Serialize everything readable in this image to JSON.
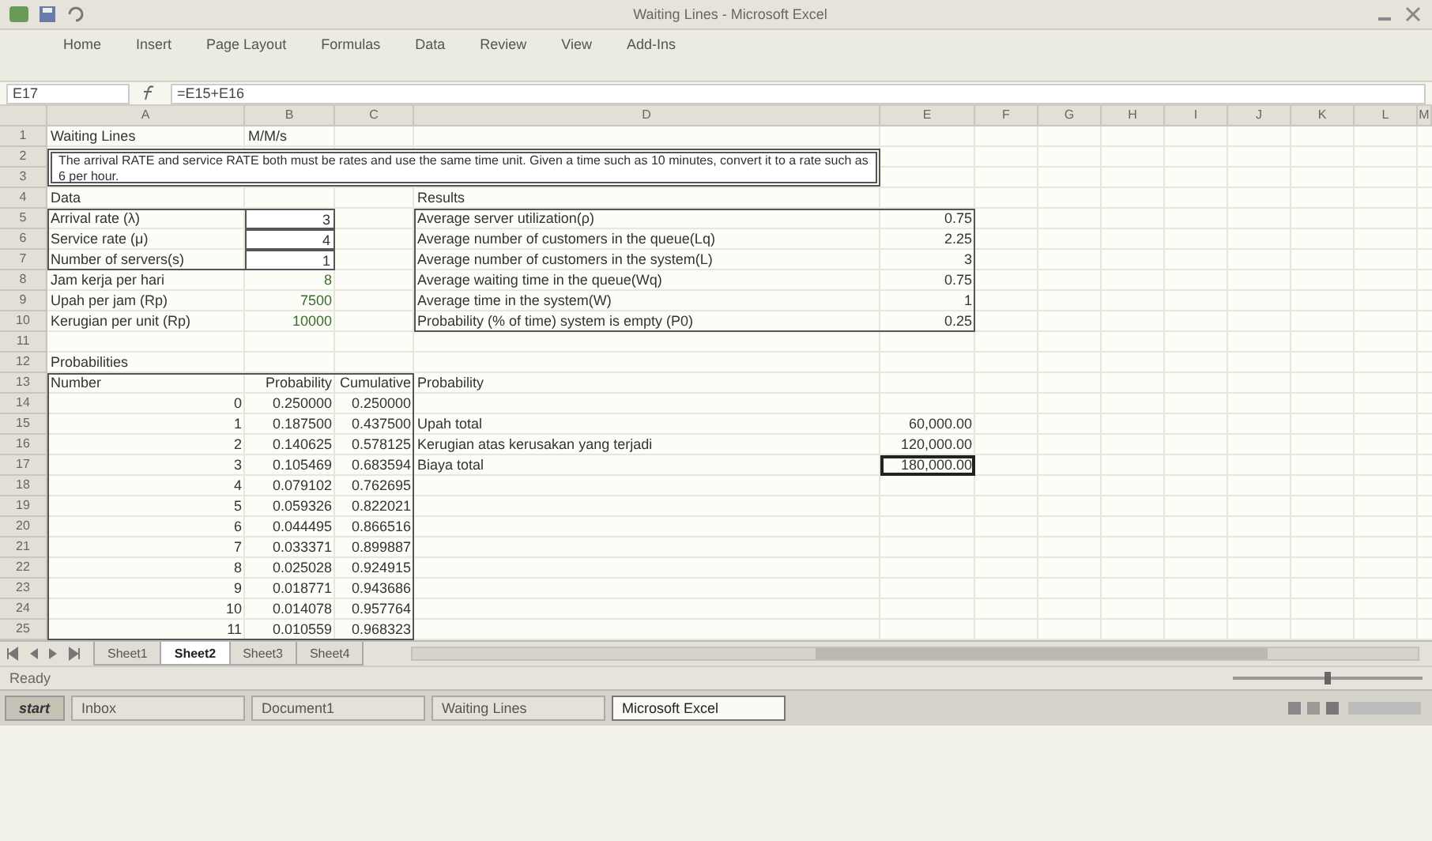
{
  "window": {
    "title": "Waiting Lines - Microsoft Excel"
  },
  "ribbon_tabs": [
    {
      "label": "Home",
      "selected": false
    },
    {
      "label": "Insert",
      "selected": false
    },
    {
      "label": "Page Layout",
      "selected": false
    },
    {
      "label": "Formulas",
      "selected": false
    },
    {
      "label": "Data",
      "selected": false
    },
    {
      "label": "Review",
      "selected": false
    },
    {
      "label": "View",
      "selected": false
    },
    {
      "label": "Add-Ins",
      "selected": false
    }
  ],
  "formula_bar": {
    "name_box": "E17",
    "formula": "=E15+E16"
  },
  "columns": [
    "A",
    "B",
    "C",
    "D",
    "E",
    "F",
    "G",
    "H",
    "I",
    "J",
    "K",
    "L",
    "M"
  ],
  "rows": [
    "1",
    "2",
    "3",
    "4",
    "5",
    "6",
    "7",
    "8",
    "9",
    "10",
    "11",
    "12",
    "13",
    "14",
    "15",
    "16",
    "17",
    "18",
    "19",
    "20",
    "21",
    "22",
    "23",
    "24",
    "25"
  ],
  "sheet": {
    "title": "Waiting Lines",
    "model": "M/M/s",
    "note": "The arrival RATE and service RATE both must be rates and use the same time unit. Given a time such as 10 minutes, convert it to a rate such as 6 per hour.",
    "data": {
      "heading": "Data",
      "inputs": [
        {
          "label": "Arrival rate (λ)",
          "value": "3"
        },
        {
          "label": "Service rate (μ)",
          "value": "4"
        },
        {
          "label": "Number of servers(s)",
          "value": "1"
        }
      ],
      "parameters": [
        {
          "label": "Jam kerja per hari",
          "value": "8"
        },
        {
          "label": "Upah per jam (Rp)",
          "value": "7500"
        },
        {
          "label": "Kerugian per unit (Rp)",
          "value": "10000"
        }
      ]
    },
    "results": {
      "heading": "Results",
      "items": [
        {
          "label": "Average server utilization(ρ)",
          "value": "0.75"
        },
        {
          "label": "Average number of customers in the queue(Lq)",
          "value": "2.25"
        },
        {
          "label": "Average number of customers in the system(L)",
          "value": "3"
        },
        {
          "label": "Average waiting time in the queue(Wq)",
          "value": "0.75"
        },
        {
          "label": "Average time in the system(W)",
          "value": "1"
        },
        {
          "label": "Probability (% of time) system is empty (P0)",
          "value": "0.25"
        }
      ]
    },
    "probabilities": {
      "heading": "Probabilities",
      "columns": [
        "Number",
        "Probability",
        "Cumulative"
      ],
      "column_4": "Probability",
      "rows": [
        {
          "number": "0",
          "probability": "0.250000",
          "cumulative": "0.250000"
        },
        {
          "number": "1",
          "probability": "0.187500",
          "cumulative": "0.437500"
        },
        {
          "number": "2",
          "probability": "0.140625",
          "cumulative": "0.578125"
        },
        {
          "number": "3",
          "probability": "0.105469",
          "cumulative": "0.683594"
        },
        {
          "number": "4",
          "probability": "0.079102",
          "cumulative": "0.762695"
        },
        {
          "number": "5",
          "probability": "0.059326",
          "cumulative": "0.822021"
        },
        {
          "number": "6",
          "probability": "0.044495",
          "cumulative": "0.866516"
        },
        {
          "number": "7",
          "probability": "0.033371",
          "cumulative": "0.899887"
        },
        {
          "number": "8",
          "probability": "0.025028",
          "cumulative": "0.924915"
        },
        {
          "number": "9",
          "probability": "0.018771",
          "cumulative": "0.943686"
        },
        {
          "number": "10",
          "probability": "0.014078",
          "cumulative": "0.957764"
        },
        {
          "number": "11",
          "probability": "0.010559",
          "cumulative": "0.968323"
        }
      ]
    },
    "costs": [
      {
        "label": "Upah total",
        "value": "60,000.00",
        "selected": false
      },
      {
        "label": "Kerugian atas kerusakan yang terjadi",
        "value": "120,000.00",
        "selected": false
      },
      {
        "label": "Biaya total",
        "value": "180,000.00",
        "selected": true
      }
    ]
  },
  "sheet_tabs": [
    {
      "label": "Sheet1",
      "selected": false
    },
    {
      "label": "Sheet2",
      "selected": true
    },
    {
      "label": "Sheet3",
      "selected": false
    },
    {
      "label": "Sheet4",
      "selected": false
    }
  ],
  "status_bar": {
    "text": "Ready",
    "zoom_slider": {
      "level": 0.5
    }
  },
  "taskbar": {
    "start": "start",
    "tasks": [
      {
        "label": "Inbox",
        "selected": false
      },
      {
        "label": "Document1",
        "selected": false
      },
      {
        "label": "Waiting Lines",
        "selected": false
      },
      {
        "label": "Microsoft Excel",
        "selected": true
      }
    ]
  }
}
